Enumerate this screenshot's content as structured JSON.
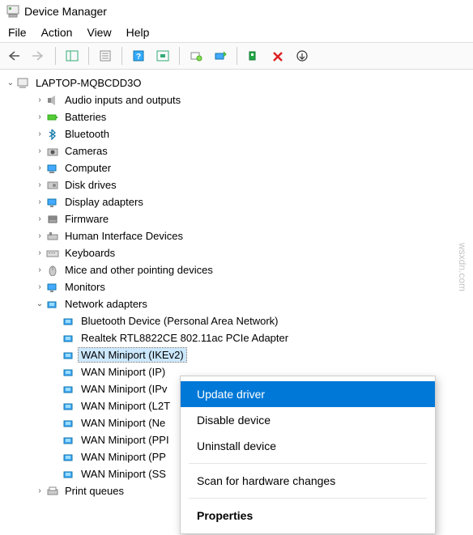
{
  "app": {
    "title": "Device Manager"
  },
  "menu": {
    "file": "File",
    "action": "Action",
    "view": "View",
    "help": "Help"
  },
  "root": {
    "name": "LAPTOP-MQBCDD3O"
  },
  "categories": [
    {
      "label": "Audio inputs and outputs",
      "icon": "audio"
    },
    {
      "label": "Batteries",
      "icon": "battery"
    },
    {
      "label": "Bluetooth",
      "icon": "bluetooth"
    },
    {
      "label": "Cameras",
      "icon": "camera"
    },
    {
      "label": "Computer",
      "icon": "computer"
    },
    {
      "label": "Disk drives",
      "icon": "disk"
    },
    {
      "label": "Display adapters",
      "icon": "display"
    },
    {
      "label": "Firmware",
      "icon": "firmware"
    },
    {
      "label": "Human Interface Devices",
      "icon": "hid"
    },
    {
      "label": "Keyboards",
      "icon": "keyboard"
    },
    {
      "label": "Mice and other pointing devices",
      "icon": "mouse"
    },
    {
      "label": "Monitors",
      "icon": "monitor"
    }
  ],
  "network": {
    "label": "Network adapters",
    "items": [
      "Bluetooth Device (Personal Area Network)",
      "Realtek RTL8822CE 802.11ac PCIe Adapter",
      "WAN Miniport (IKEv2)",
      "WAN Miniport (IP)",
      "WAN Miniport (IPv",
      "WAN Miniport (L2T",
      "WAN Miniport (Ne",
      "WAN Miniport (PPI",
      "WAN Miniport (PP",
      "WAN Miniport (SS"
    ],
    "selected_index": 2
  },
  "printqueues": {
    "label": "Print queues"
  },
  "context_menu": {
    "update": "Update driver",
    "disable": "Disable device",
    "uninstall": "Uninstall device",
    "scan": "Scan for hardware changes",
    "properties": "Properties"
  },
  "watermark": "wsxdn.com"
}
